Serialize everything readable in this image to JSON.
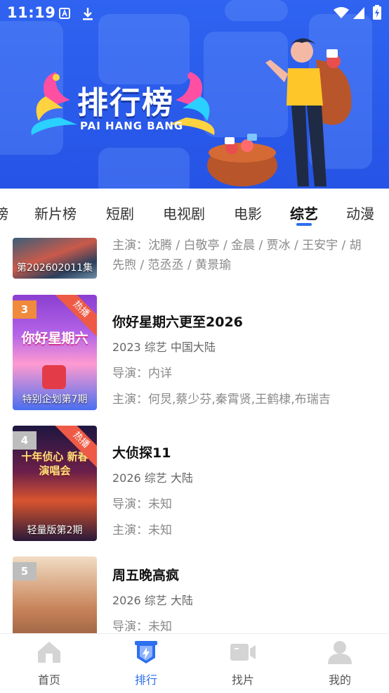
{
  "status_bar": {
    "time": "11:19"
  },
  "banner": {
    "title_cn": "排行榜",
    "title_en": "PAI HANG BANG"
  },
  "tabs": [
    {
      "label": "榜"
    },
    {
      "label": "新片榜"
    },
    {
      "label": "短剧"
    },
    {
      "label": "电视剧"
    },
    {
      "label": "电影"
    },
    {
      "label": "综艺",
      "active": true
    },
    {
      "label": "动漫"
    }
  ],
  "list": {
    "partial_item": {
      "episode": "第202602011集",
      "cast": "主演：沈腾 / 白敬亭 / 金晨 / 贾冰 / 王安宇 / 胡先煦 / 范丞丞 / 黄景瑜"
    },
    "items": [
      {
        "rank": "3",
        "badge": "热播",
        "episode": "特别企划第7期",
        "title": "你好星期六更至2026",
        "meta": "2023  综艺  中国大陆",
        "director": "导演：内详",
        "cast": "主演：何炅,蔡少芬,秦霄贤,王鹤棣,布瑞吉",
        "poster_text": "你好星期六"
      },
      {
        "rank": "4",
        "badge": "热播",
        "episode": "轻量版第2期",
        "title": "大侦探11",
        "meta": "2026  综艺  大陆",
        "director": "导演：未知",
        "cast": "主演：未知",
        "poster_text": "十年侦心 新春演唱会"
      },
      {
        "rank": "5",
        "badge": "",
        "episode": "",
        "title": "周五晚高疯",
        "meta": "2026  综艺  大陆",
        "director": "导演：未知",
        "cast": "",
        "poster_text": ""
      }
    ]
  },
  "bottom_nav": [
    {
      "label": "首页",
      "icon": "home-icon"
    },
    {
      "label": "排行",
      "icon": "ranking-icon",
      "active": true
    },
    {
      "label": "找片",
      "icon": "video-camera-icon"
    },
    {
      "label": "我的",
      "icon": "user-icon"
    }
  ],
  "colors": {
    "accent": "#2c6ff0",
    "banner_blue": "#2f63f0",
    "hot_badge": "#ee5a45",
    "rank_orange": "#f08a3c",
    "rank_grey": "#bdbdbd"
  }
}
